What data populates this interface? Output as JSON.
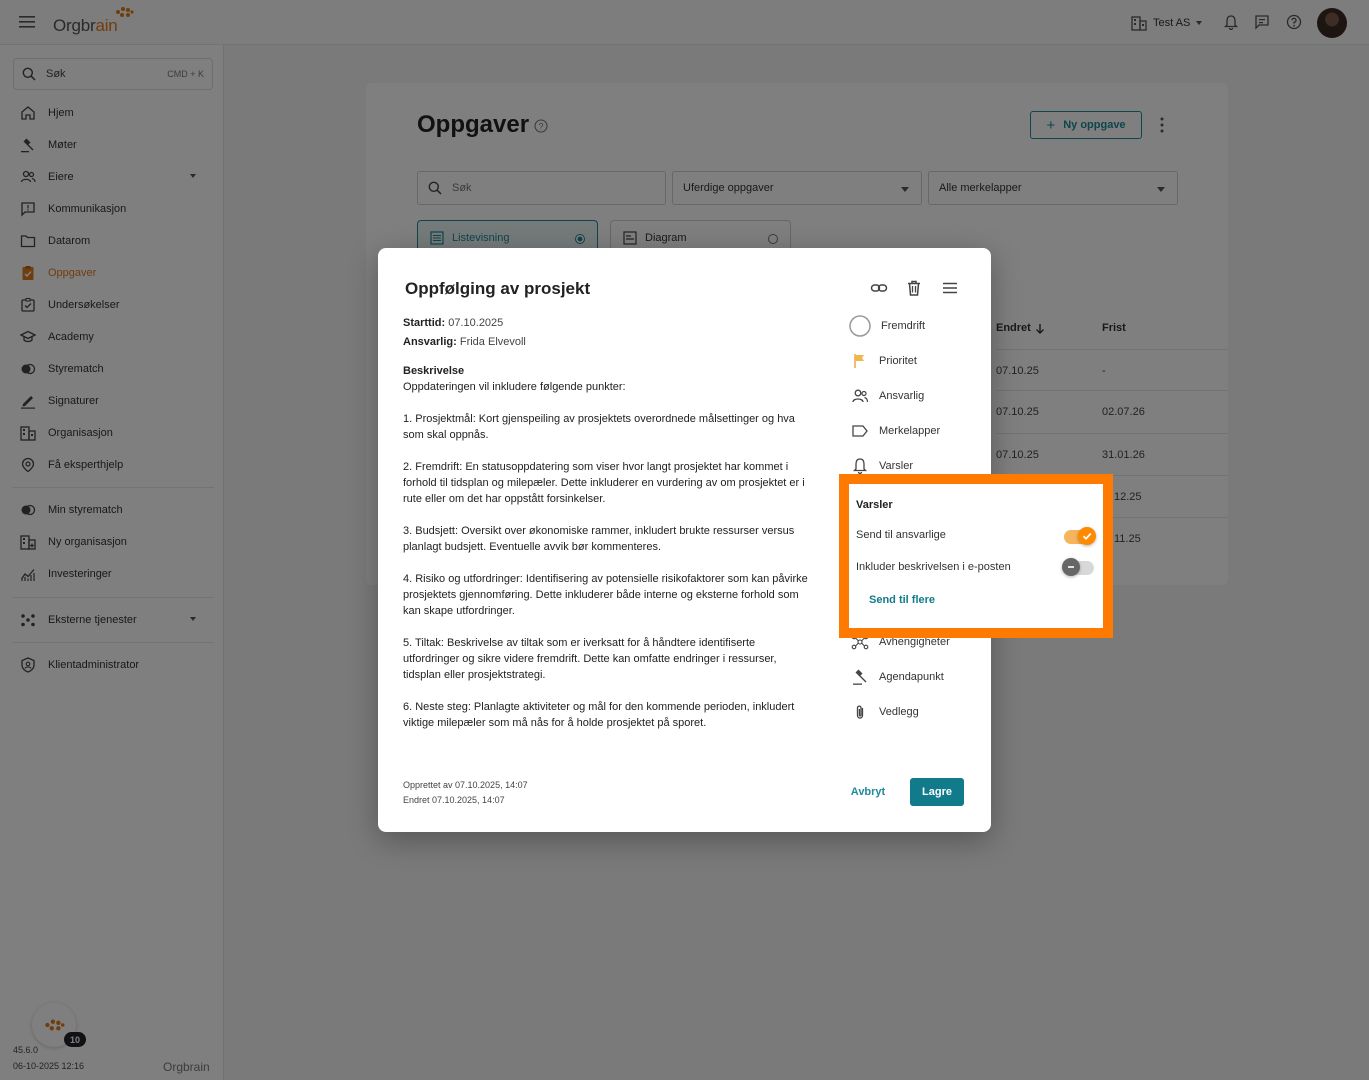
{
  "topbar": {
    "logo_text": "Orgbrain",
    "org_name": "Test AS"
  },
  "sidebar": {
    "search_placeholder": "Søk",
    "search_shortcut": "CMD + K",
    "items": [
      {
        "label": "Hjem",
        "icon": "home-icon"
      },
      {
        "label": "Møter",
        "icon": "gavel-icon"
      },
      {
        "label": "Eiere",
        "icon": "owners-icon"
      },
      {
        "label": "Kommunikasjon",
        "icon": "chat-icon"
      },
      {
        "label": "Datarom",
        "icon": "folder-icon"
      },
      {
        "label": "Oppgaver",
        "icon": "tasks-icon"
      },
      {
        "label": "Undersøkelser",
        "icon": "survey-icon"
      },
      {
        "label": "Academy",
        "icon": "academy-icon"
      },
      {
        "label": "Styrematch",
        "icon": "match-icon"
      },
      {
        "label": "Signaturer",
        "icon": "signature-icon"
      },
      {
        "label": "Organisasjon",
        "icon": "building-icon"
      },
      {
        "label": "Få eksperthjelp",
        "icon": "expert-icon"
      },
      {
        "label": "Min styrematch",
        "icon": "match-icon"
      },
      {
        "label": "Ny organisasjon",
        "icon": "building-add-icon"
      },
      {
        "label": "Investeringer",
        "icon": "chart-icon"
      },
      {
        "label": "Eksterne tjenester",
        "icon": "services-icon"
      },
      {
        "label": "Klientadministrator",
        "icon": "admin-icon"
      }
    ],
    "active": "Oppgaver",
    "fab_badge": "10",
    "version": "45.6.0",
    "build_date": "06-10-2025 12:16",
    "footer_logo": "Orgbrain"
  },
  "main": {
    "title": "Oppgaver",
    "new_task_label": "Ny oppgave",
    "search_placeholder": "Søk",
    "status_filter": "Uferdige oppgaver",
    "tag_filter": "Alle merkelapper",
    "view_list": "Listevisning",
    "view_chart": "Diagram",
    "table": {
      "headers": {
        "changed": "Endret",
        "deadline": "Frist"
      },
      "rows": [
        {
          "changed": "07.10.25",
          "deadline": "-"
        },
        {
          "changed": "07.10.25",
          "deadline": "02.07.26"
        },
        {
          "changed": "07.10.25",
          "deadline": "31.01.26"
        },
        {
          "changed": "",
          "deadline": "12.25"
        },
        {
          "changed": "",
          "deadline": "11.25"
        }
      ]
    }
  },
  "modal": {
    "title": "Oppfølging av prosjekt",
    "start_label": "Starttid:",
    "start_value": "07.10.2025",
    "owner_label": "Ansvarlig:",
    "owner_value": "Frida Elvevoll",
    "description_heading": "Beskrivelse",
    "description_intro": "Oppdateringen vil inkludere følgende punkter:",
    "description_points": [
      "1. Prosjektmål: Kort gjenspeiling av prosjektets overordnede målsettinger og hva som skal oppnås.",
      "2. Fremdrift: En statusoppdatering som viser hvor langt prosjektet har kommet i forhold til tidsplan og milepæler. Dette inkluderer en vurdering av om prosjektet er i rute eller om det har oppstått forsinkelser.",
      "3. Budsjett: Oversikt over økonomiske rammer, inkludert brukte ressurser versus planlagt budsjett. Eventuelle avvik bør kommenteres.",
      "4. Risiko og utfordringer: Identifisering av potensielle risikofaktorer som kan påvirke prosjektets gjennomføring. Dette inkluderer både interne og eksterne forhold som kan skape utfordringer.",
      "5. Tiltak: Beskrivelse av tiltak som er iverksatt for å håndtere identifiserte utfordringer og sikre videre fremdrift. Dette kan omfatte endringer i ressurser, tidsplan eller prosjektstrategi.",
      "6. Neste steg: Planlagte aktiviteter og mål for den kommende perioden, inkludert viktige milepæler som må nås for å holde prosjektet på sporet."
    ],
    "created": "Opprettet av 07.10.2025, 14:07",
    "changed": "Endret 07.10.2025, 14:07",
    "side_items": {
      "progress": "Fremdrift",
      "priority": "Prioritet",
      "owner": "Ansvarlig",
      "tags": "Merkelapper",
      "notifications": "Varsler",
      "dependencies": "Avhengigheter",
      "agenda": "Agendapunkt",
      "attachments": "Vedlegg"
    },
    "cancel_label": "Avbryt",
    "save_label": "Lagre"
  },
  "notifications_popover": {
    "title": "Varsler",
    "send_to_owners_label": "Send til ansvarlige",
    "send_to_owners_on": true,
    "include_description_label": "Inkluder beskrivelsen i e-posten",
    "include_description_on": false,
    "send_more_label": "Send til flere"
  },
  "colors": {
    "accent_orange": "#e07b1c",
    "highlight_orange": "#ff7a00",
    "teal": "#117a8b"
  }
}
